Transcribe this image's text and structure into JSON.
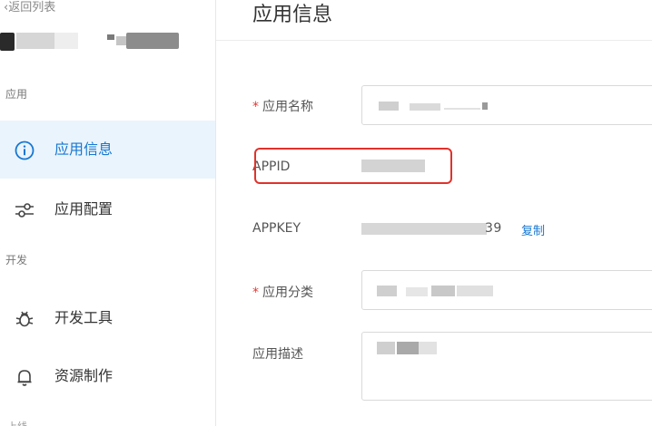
{
  "sidebar": {
    "back_label": "返回列表",
    "sections": {
      "app": "应用",
      "dev": "开发",
      "online": "上线"
    },
    "items": [
      {
        "label": "应用信息",
        "icon": "info-icon",
        "active": true
      },
      {
        "label": "应用配置",
        "icon": "sliders-icon",
        "active": false
      },
      {
        "label": "开发工具",
        "icon": "bug-icon",
        "active": false
      },
      {
        "label": "资源制作",
        "icon": "bell-icon",
        "active": false
      }
    ]
  },
  "main": {
    "title": "应用信息",
    "fields": {
      "app_name_label": "应用名称",
      "appid_label": "APPID",
      "appkey_label": "APPKEY",
      "appkey_value_tail": "39",
      "copy_label": "复制",
      "category_label": "应用分类",
      "description_label": "应用描述"
    }
  },
  "colors": {
    "accent": "#1677d2",
    "active_bg": "#eaf4fc",
    "required": "#e53935",
    "highlight": "#e0322b"
  }
}
